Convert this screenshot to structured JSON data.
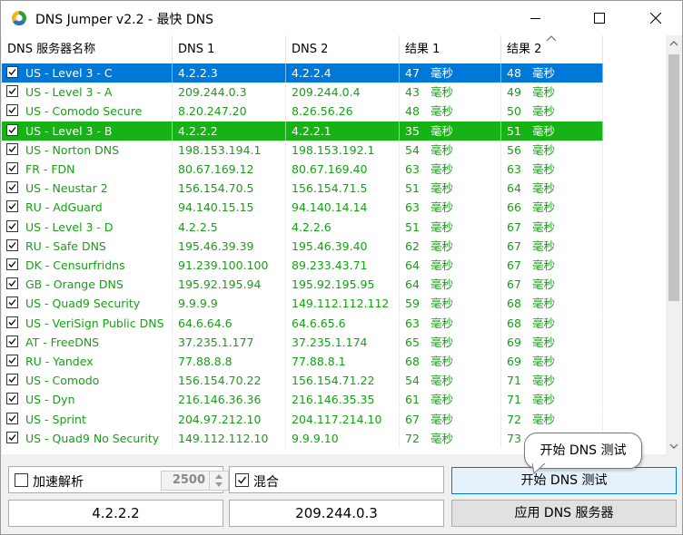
{
  "window": {
    "title": "DNS Jumper v2.2 - 最快 DNS"
  },
  "colors": {
    "selection_blue": "#0078d7",
    "fastest_green": "#16b216",
    "text_green": "#16a016"
  },
  "table": {
    "columns": [
      "DNS 服务器名称",
      "DNS 1",
      "DNS 2",
      "结果 1",
      "结果 2"
    ],
    "sort_indicator": "ascending",
    "rows": [
      {
        "name": "US - Level 3 - C",
        "dns1": "4.2.2.3",
        "dns2": "4.2.2.4",
        "r1": "47",
        "u1": "毫秒",
        "r2": "48",
        "u2": "毫秒",
        "checked": true,
        "state": "selected"
      },
      {
        "name": "US - Level 3 - A",
        "dns1": "209.244.0.3",
        "dns2": "209.244.0.4",
        "r1": "43",
        "u1": "毫秒",
        "r2": "49",
        "u2": "毫秒",
        "checked": true,
        "state": "normal"
      },
      {
        "name": "US - Comodo Secure",
        "dns1": "8.20.247.20",
        "dns2": "8.26.56.26",
        "r1": "48",
        "u1": "毫秒",
        "r2": "50",
        "u2": "毫秒",
        "checked": true,
        "state": "normal"
      },
      {
        "name": "US - Level 3 - B",
        "dns1": "4.2.2.2",
        "dns2": "4.2.2.1",
        "r1": "35",
        "u1": "毫秒",
        "r2": "51",
        "u2": "毫秒",
        "checked": true,
        "state": "fastest"
      },
      {
        "name": "US - Norton DNS",
        "dns1": "198.153.194.1",
        "dns2": "198.153.192.1",
        "r1": "54",
        "u1": "毫秒",
        "r2": "56",
        "u2": "毫秒",
        "checked": true,
        "state": "normal"
      },
      {
        "name": "FR - FDN",
        "dns1": "80.67.169.12",
        "dns2": "80.67.169.40",
        "r1": "63",
        "u1": "毫秒",
        "r2": "63",
        "u2": "毫秒",
        "checked": true,
        "state": "normal"
      },
      {
        "name": "US - Neustar 2",
        "dns1": "156.154.70.5",
        "dns2": "156.154.71.5",
        "r1": "51",
        "u1": "毫秒",
        "r2": "64",
        "u2": "毫秒",
        "checked": true,
        "state": "normal"
      },
      {
        "name": "RU - AdGuard",
        "dns1": "94.140.15.15",
        "dns2": "94.140.14.14",
        "r1": "63",
        "u1": "毫秒",
        "r2": "66",
        "u2": "毫秒",
        "checked": true,
        "state": "normal"
      },
      {
        "name": "US - Level 3 - D",
        "dns1": "4.2.2.5",
        "dns2": "4.2.2.6",
        "r1": "51",
        "u1": "毫秒",
        "r2": "67",
        "u2": "毫秒",
        "checked": true,
        "state": "normal"
      },
      {
        "name": "RU - Safe DNS",
        "dns1": "195.46.39.39",
        "dns2": "195.46.39.40",
        "r1": "62",
        "u1": "毫秒",
        "r2": "67",
        "u2": "毫秒",
        "checked": true,
        "state": "normal"
      },
      {
        "name": "DK - Censurfridns",
        "dns1": "91.239.100.100",
        "dns2": "89.233.43.71",
        "r1": "64",
        "u1": "毫秒",
        "r2": "67",
        "u2": "毫秒",
        "checked": true,
        "state": "normal"
      },
      {
        "name": "GB - Orange DNS",
        "dns1": "195.92.195.94",
        "dns2": "195.92.195.95",
        "r1": "64",
        "u1": "毫秒",
        "r2": "67",
        "u2": "毫秒",
        "checked": true,
        "state": "normal"
      },
      {
        "name": "US - Quad9 Security",
        "dns1": "9.9.9.9",
        "dns2": "149.112.112.112",
        "r1": "59",
        "u1": "毫秒",
        "r2": "68",
        "u2": "毫秒",
        "checked": true,
        "state": "normal"
      },
      {
        "name": "US - VeriSign Public DNS",
        "dns1": "64.6.64.6",
        "dns2": "64.6.65.6",
        "r1": "63",
        "u1": "毫秒",
        "r2": "68",
        "u2": "毫秒",
        "checked": true,
        "state": "normal"
      },
      {
        "name": "AT - FreeDNS",
        "dns1": "37.235.1.177",
        "dns2": "37.235.1.174",
        "r1": "65",
        "u1": "毫秒",
        "r2": "69",
        "u2": "毫秒",
        "checked": true,
        "state": "normal"
      },
      {
        "name": "RU - Yandex",
        "dns1": "77.88.8.8",
        "dns2": "77.88.8.1",
        "r1": "68",
        "u1": "毫秒",
        "r2": "69",
        "u2": "毫秒",
        "checked": true,
        "state": "normal"
      },
      {
        "name": "US - Comodo",
        "dns1": "156.154.70.22",
        "dns2": "156.154.71.22",
        "r1": "54",
        "u1": "毫秒",
        "r2": "71",
        "u2": "毫秒",
        "checked": true,
        "state": "normal"
      },
      {
        "name": "US - Dyn",
        "dns1": "216.146.36.36",
        "dns2": "216.146.35.35",
        "r1": "61",
        "u1": "毫秒",
        "r2": "71",
        "u2": "毫秒",
        "checked": true,
        "state": "normal"
      },
      {
        "name": "US - Sprint",
        "dns1": "204.97.212.10",
        "dns2": "204.117.214.10",
        "r1": "67",
        "u1": "毫秒",
        "r2": "72",
        "u2": "毫秒",
        "checked": true,
        "state": "normal"
      },
      {
        "name": "US - Quad9 No Security",
        "dns1": "149.112.112.10",
        "dns2": "9.9.9.10",
        "r1": "72",
        "u1": "毫秒",
        "r2": "73",
        "u2": "毫秒",
        "checked": true,
        "state": "normal"
      }
    ]
  },
  "controls": {
    "fast_resolve_label": "加速解析",
    "fast_resolve_checked": false,
    "fast_resolve_value": "2500",
    "mixed_label": "混合",
    "mixed_checked": true,
    "dns1_value": "4.2.2.2",
    "dns2_value": "209.244.0.3",
    "start_button": "开始 DNS 测试",
    "apply_button": "应用 DNS 服务器",
    "tooltip": "开始 DNS 测试"
  }
}
